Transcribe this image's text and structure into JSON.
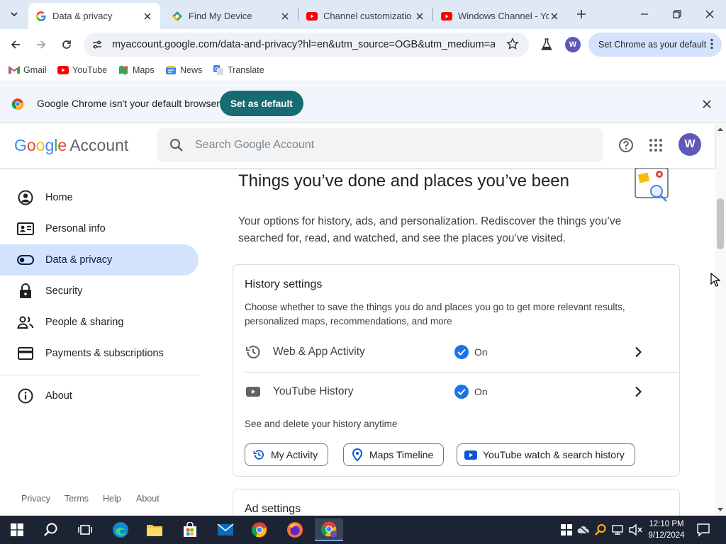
{
  "browser": {
    "tabs": [
      {
        "title": "Data & privacy",
        "active": true,
        "favicon": "google-g-icon"
      },
      {
        "title": "Find My Device",
        "active": false,
        "favicon": "find-my-device-icon"
      },
      {
        "title": "Channel customizatio",
        "active": false,
        "favicon": "youtube-icon"
      },
      {
        "title": "Windows Channel - Yo",
        "active": false,
        "favicon": "youtube-icon"
      }
    ],
    "url": "myaccount.google.com/data-and-privacy?hl=en&utm_source=OGB&utm_medium=act",
    "profile_initial": "W",
    "set_chrome_default_label": "Set Chrome as your default",
    "bookmarks": [
      {
        "label": "Gmail",
        "icon": "gmail-icon"
      },
      {
        "label": "YouTube",
        "icon": "youtube-icon"
      },
      {
        "label": "Maps",
        "icon": "maps-icon"
      },
      {
        "label": "News",
        "icon": "news-icon"
      },
      {
        "label": "Translate",
        "icon": "translate-icon"
      }
    ],
    "infobar": {
      "message": "Google Chrome isn't your default browser",
      "button": "Set as default"
    }
  },
  "account_header": {
    "logo_google": "Google",
    "logo_account": "Account",
    "search_placeholder": "Search Google Account",
    "avatar_initial": "W"
  },
  "sidebar": {
    "items": [
      {
        "label": "Home",
        "icon": "home-icon",
        "active": false
      },
      {
        "label": "Personal info",
        "icon": "personal-info-icon",
        "active": false
      },
      {
        "label": "Data & privacy",
        "icon": "toggle-icon",
        "active": true
      },
      {
        "label": "Security",
        "icon": "lock-icon",
        "active": false
      },
      {
        "label": "People & sharing",
        "icon": "people-icon",
        "active": false
      },
      {
        "label": "Payments & subscriptions",
        "icon": "credit-card-icon",
        "active": false
      },
      {
        "label": "About",
        "icon": "info-icon",
        "active": false
      }
    ],
    "footer": [
      "Privacy",
      "Terms",
      "Help",
      "About"
    ]
  },
  "main": {
    "title": "Things you’ve done and places you’ve been",
    "description": "Your options for history, ads, and personalization. Rediscover the things you’ve searched for, read, and watched, and see the places you’ve visited.",
    "history_card": {
      "title": "History settings",
      "description": "Choose whether to save the things you do and places you go to get more relevant results, personalized maps, recommendations, and more",
      "rows": [
        {
          "label": "Web & App Activity",
          "status": "On",
          "icon": "history-icon"
        },
        {
          "label": "YouTube History",
          "status": "On",
          "icon": "youtube-play-icon"
        }
      ],
      "see_delete_label": "See and delete your history anytime",
      "chips": [
        {
          "label": "My Activity",
          "icon": "history-icon"
        },
        {
          "label": "Maps Timeline",
          "icon": "map-pin-icon"
        },
        {
          "label": "YouTube watch & search history",
          "icon": "youtube-icon"
        }
      ]
    },
    "ad_card": {
      "title": "Ad settings"
    }
  },
  "taskbar": {
    "time": "12:10 PM",
    "date": "9/12/2024"
  },
  "colors": {
    "accent": "#1a73e8",
    "active_nav": "#d3e3fd",
    "set_default_button": "#176b72",
    "taskbar": "#1c2433"
  }
}
